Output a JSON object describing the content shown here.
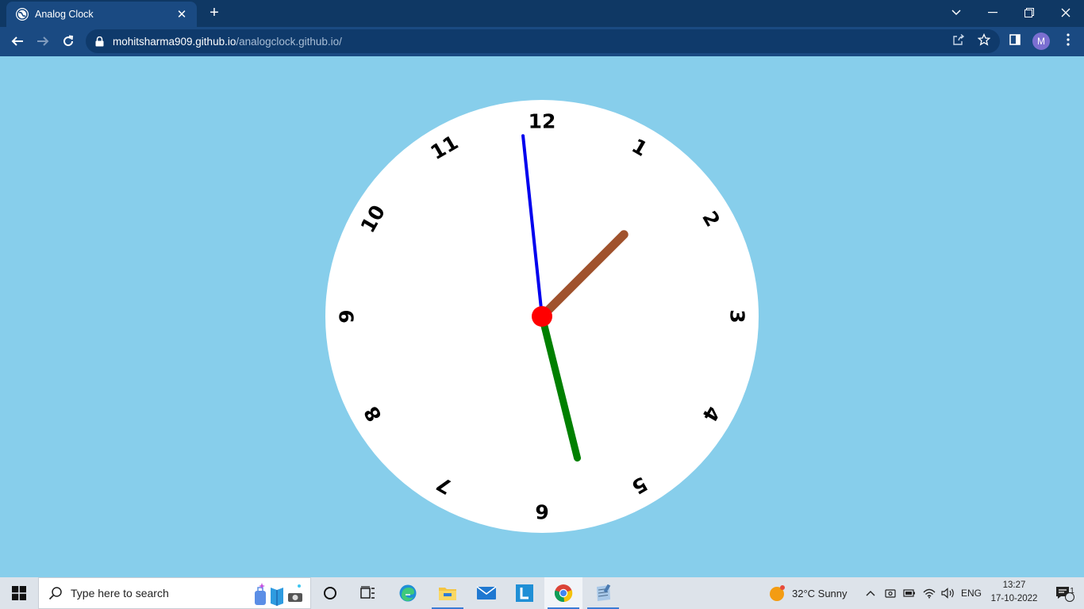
{
  "browser": {
    "tab_title": "Analog Clock",
    "url_host": "mohitsharma909.github.io",
    "url_path": "/analogclock.github.io/",
    "profile_initial": "M"
  },
  "clock": {
    "numerals": [
      "12",
      "1",
      "2",
      "3",
      "4",
      "5",
      "6",
      "7",
      "8",
      "9",
      "10",
      "11"
    ],
    "hour_hand_color": "#a0522d",
    "minute_hand_color": "#008000",
    "second_hand_color": "#0000ee",
    "center_dot_color": "#ff0000",
    "hour_hand_angle_deg": 45,
    "minute_hand_angle_deg": 166,
    "second_hand_angle_deg": 354
  },
  "taskbar": {
    "search_placeholder": "Type here to search",
    "weather": "32°C  Sunny",
    "language": "ENG",
    "time": "13:27",
    "date": "17-10-2022",
    "notification_count": "1"
  }
}
